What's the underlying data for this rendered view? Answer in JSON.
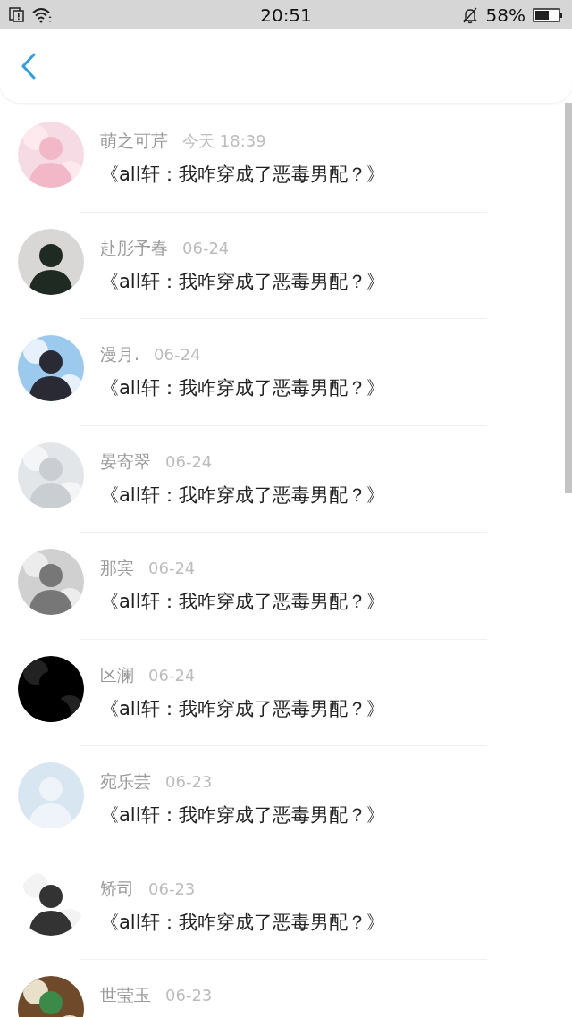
{
  "status_bar": {
    "time": "20:51",
    "battery": "58%"
  },
  "comments": [
    {
      "name": "萌之可芹",
      "time": "今天 18:39",
      "message": "《all轩：我咋穿成了恶毒男配？》"
    },
    {
      "name": "赴彤予春",
      "time": "06-24",
      "message": "《all轩：我咋穿成了恶毒男配？》"
    },
    {
      "name": "漫月.",
      "time": "06-24",
      "message": "《all轩：我咋穿成了恶毒男配？》"
    },
    {
      "name": "晏寄翠",
      "time": "06-24",
      "message": "《all轩：我咋穿成了恶毒男配？》"
    },
    {
      "name": "那宾",
      "time": "06-24",
      "message": "《all轩：我咋穿成了恶毒男配？》"
    },
    {
      "name": "区澜",
      "time": "06-24",
      "message": "《all轩：我咋穿成了恶毒男配？》"
    },
    {
      "name": "宛乐芸",
      "time": "06-23",
      "message": "《all轩：我咋穿成了恶毒男配？》"
    },
    {
      "name": "矫司",
      "time": "06-23",
      "message": "《all轩：我咋穿成了恶毒男配？》"
    },
    {
      "name": "世莹玉",
      "time": "06-23"
    }
  ]
}
